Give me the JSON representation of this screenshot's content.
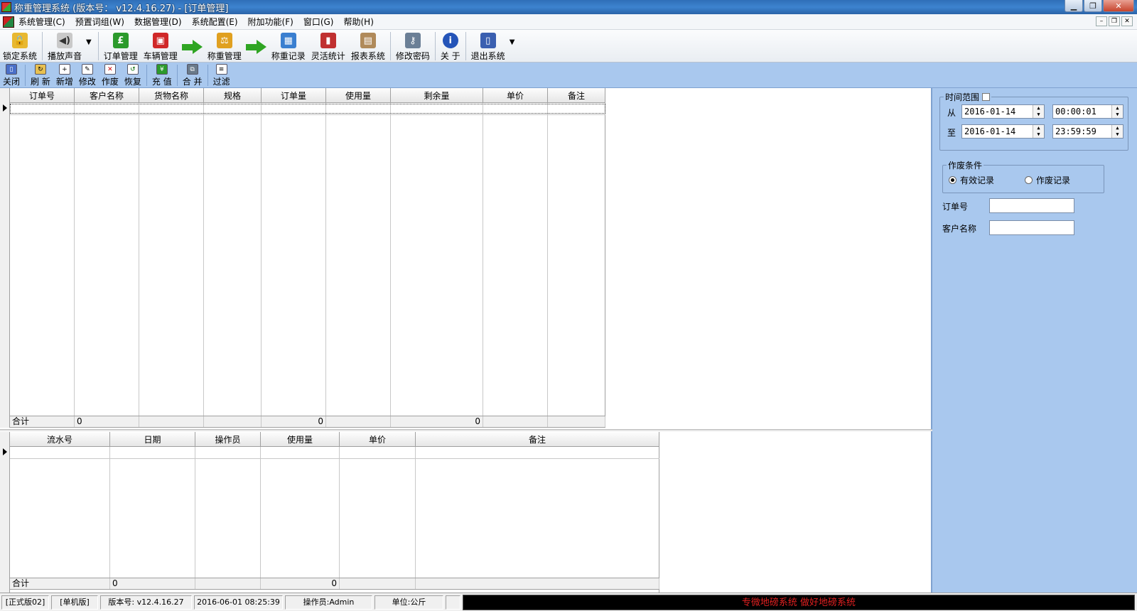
{
  "window": {
    "title": "称重管理系统 (版本号： v12.4.16.27) - [订单管理]"
  },
  "menu": [
    "系统管理(C)",
    "预置词组(W)",
    "数据管理(D)",
    "系统配置(E)",
    "附加功能(F)",
    "窗口(G)",
    "帮助(H)"
  ],
  "toolbar": {
    "lock": "锁定系统",
    "sound": "播放声音",
    "orders": "订单管理",
    "vehicles": "车辆管理",
    "weighing": "称重管理",
    "records": "称重记录",
    "stats": "灵活统计",
    "reports": "报表系统",
    "password": "修改密码",
    "about": "关 于",
    "exit": "退出系统"
  },
  "subtoolbar": {
    "close": "关闭",
    "refresh": "刷 新",
    "add": "新增",
    "edit": "修改",
    "void": "作废",
    "restore": "恢复",
    "recharge": "充 值",
    "merge": "合 并",
    "filter": "过滤"
  },
  "grid1": {
    "columns": [
      "订单号",
      "客户名称",
      "货物名称",
      "规格",
      "订单量",
      "使用量",
      "剩余量",
      "单价",
      "备注"
    ],
    "footer": {
      "label": "合计",
      "customer": "0",
      "order_qty": "0",
      "remaining": "0"
    }
  },
  "grid2": {
    "columns": [
      "流水号",
      "日期",
      "操作员",
      "使用量",
      "单价",
      "备注"
    ],
    "footer": {
      "label": "合计",
      "date": "0",
      "used": "0"
    }
  },
  "filter": {
    "time_range_title": "时间范围",
    "from_label": "从",
    "to_label": "至",
    "from_date": "2016-01-14",
    "from_time": "00:00:01",
    "to_date": "2016-01-14",
    "to_time": "23:59:59",
    "void_title": "作废条件",
    "valid_label": "有效记录",
    "void_label": "作废记录",
    "order_no_label": "订单号",
    "customer_label": "客户名称"
  },
  "status": {
    "edition": "[正式版02]",
    "mode": "[单机版]",
    "version": "版本号: v12.4.16.27",
    "datetime": "2016-06-01 08:25:39",
    "operator": "操作员:Admin",
    "unit": "单位:公斤",
    "marquee": "专微地磅系统  做好地磅系统"
  },
  "colors": {
    "accent": "#a9c8ee",
    "marquee_text": "#e02020"
  },
  "icons": [
    "lock-icon",
    "speaker-icon",
    "pound-icon",
    "truck-icon",
    "arrow-right-icon",
    "scale-icon",
    "table-icon",
    "chart-icon",
    "clipboard-icon",
    "key-icon",
    "info-icon",
    "door-icon"
  ]
}
